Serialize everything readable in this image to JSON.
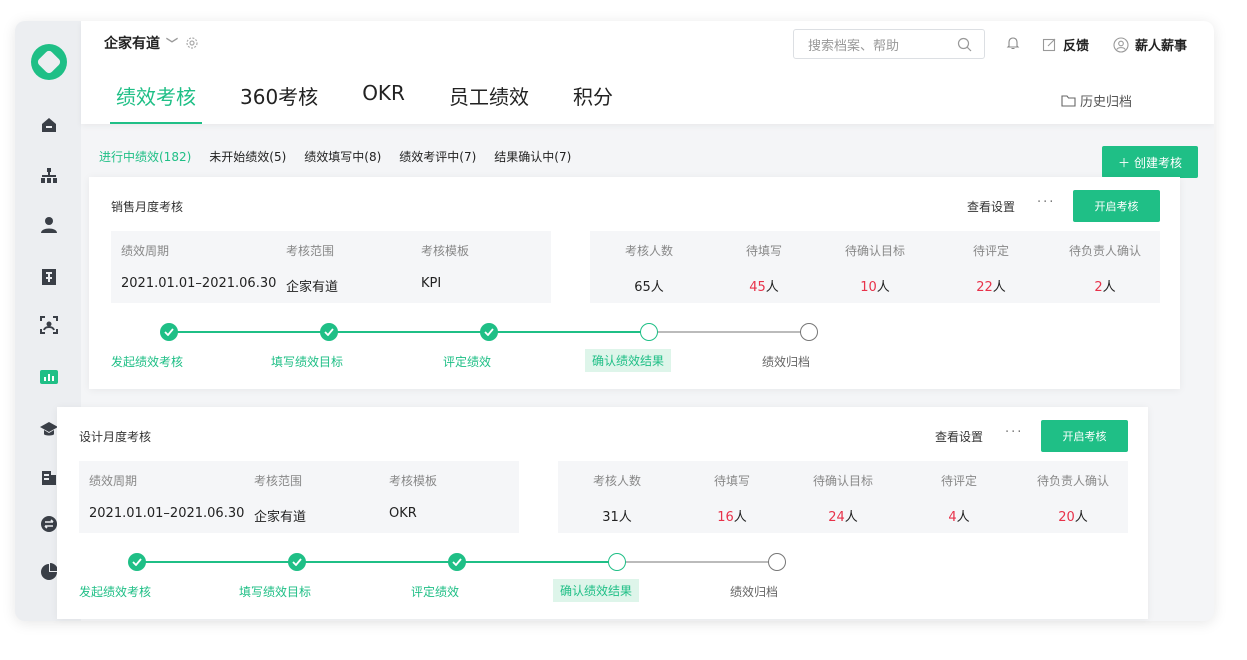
{
  "header": {
    "company": "企家有道",
    "search_placeholder": "搜索档案、帮助",
    "feedback": "反馈",
    "user": "薪人薪事",
    "history": "历史归档"
  },
  "tabs": [
    "绩效考核",
    "360考核",
    "OKR",
    "员工绩效",
    "积分"
  ],
  "filters": [
    "进行中绩效(182)",
    "未开始绩效(5)",
    "绩效填写中(8)",
    "绩效考评中(7)",
    "结果确认中(7)"
  ],
  "create_button": "创建考核",
  "card_labels": {
    "view_settings": "查看设置",
    "more": "···",
    "open_button": "开启考核",
    "period_h": "绩效周期",
    "scope_h": "考核范围",
    "template_h": "考核模板",
    "stat_headers": [
      "考核人数",
      "待填写",
      "待确认目标",
      "待评定",
      "待负责人确认"
    ],
    "unit": "人"
  },
  "steps": [
    "发起绩效考核",
    "填写绩效目标",
    "评定绩效",
    "确认绩效结果",
    "绩效归档"
  ],
  "cards": [
    {
      "title": "销售月度考核",
      "period": "2021.01.01–2021.06.30",
      "scope": "企家有道",
      "template": "KPI",
      "stats": [
        "65",
        "45",
        "10",
        "22",
        "2"
      ]
    },
    {
      "title": "设计月度考核",
      "period": "2021.01.01–2021.06.30",
      "scope": "企家有道",
      "template": "OKR",
      "stats": [
        "31",
        "16",
        "24",
        "4",
        "20"
      ]
    }
  ],
  "colors": {
    "accent": "#1fbf86",
    "danger": "#e8324a"
  }
}
